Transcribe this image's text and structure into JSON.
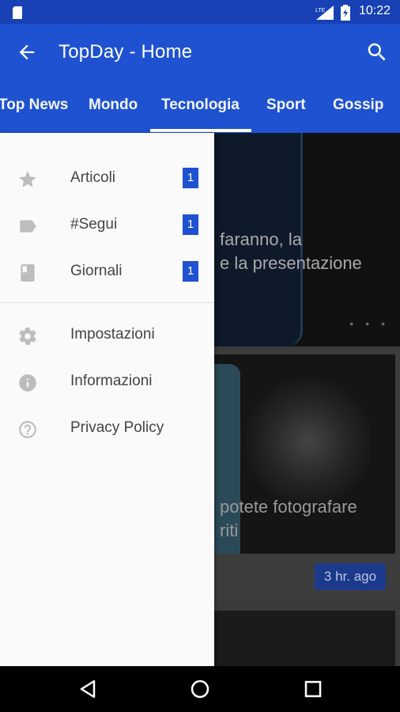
{
  "status_bar": {
    "time": "10:22",
    "network": "LTE"
  },
  "app_bar": {
    "title": "TopDay - Home"
  },
  "tabs": [
    "Top News",
    "Mondo",
    "Tecnologia",
    "Sport",
    "Gossip"
  ],
  "selected_tab": "Tecnologia",
  "drawer": {
    "items": [
      {
        "label": "Articoli",
        "icon": "star-icon",
        "count": "1"
      },
      {
        "label": "#Segui",
        "icon": "tag-icon",
        "count": "1"
      },
      {
        "label": "Giornali",
        "icon": "book-icon",
        "count": "1"
      },
      {
        "label": "Impostazioni",
        "icon": "gear-icon"
      },
      {
        "label": "Informazioni",
        "icon": "info-icon"
      },
      {
        "label": "Privacy Policy",
        "icon": "help-icon"
      }
    ]
  },
  "feed": {
    "card1_line1": "faranno, la",
    "card1_line2": "e la presentazione",
    "card2_line1": "potete fotografare",
    "card2_line2": "riti",
    "card2_time": "3 hr. ago"
  },
  "colors": {
    "primary": "#1f52d1",
    "status_bar": "#1741b5",
    "badge": "#1f52d1"
  }
}
